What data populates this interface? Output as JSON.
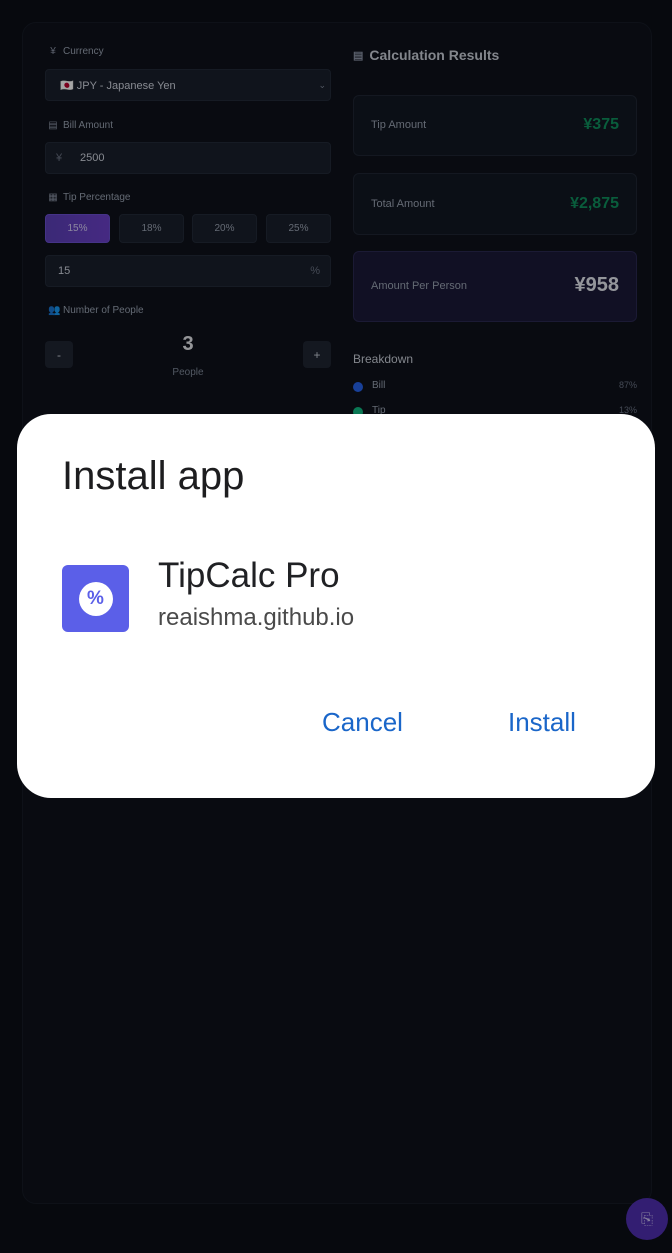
{
  "left": {
    "currency": {
      "label": "Currency",
      "value": "🇯🇵 JPY - Japanese Yen"
    },
    "bill": {
      "label": "Bill Amount",
      "symbol": "¥",
      "value": "2500"
    },
    "tip": {
      "label": "Tip Percentage",
      "options": [
        "15%",
        "18%",
        "20%",
        "25%"
      ],
      "active_index": 0,
      "custom_value": "15",
      "custom_suffix": "%"
    },
    "people": {
      "label": "Number of People",
      "minus": "-",
      "plus": "+",
      "count": "3",
      "unit": "People"
    }
  },
  "results": {
    "title": "Calculation Results",
    "tip_label": "Tip Amount",
    "tip_value": "¥375",
    "total_label": "Total Amount",
    "total_value": "¥2,875",
    "per_person_label": "Amount Per Person",
    "per_person_value": "¥958",
    "breakdown": {
      "title": "Breakdown",
      "items": [
        {
          "label": "Bill",
          "pct": "87%",
          "color": "#2563eb"
        },
        {
          "label": "Tip",
          "pct": "13%",
          "color": "#10b981"
        }
      ]
    }
  },
  "dialog": {
    "title": "Install app",
    "app_name": "TipCalc Pro",
    "app_origin": "reaishma.github.io",
    "app_icon_glyph": "%",
    "cancel_label": "Cancel",
    "install_label": "Install"
  },
  "colors": {
    "accent": "#5b5fe8",
    "button_text": "#1a66c9",
    "success": "#0f8f5c"
  }
}
